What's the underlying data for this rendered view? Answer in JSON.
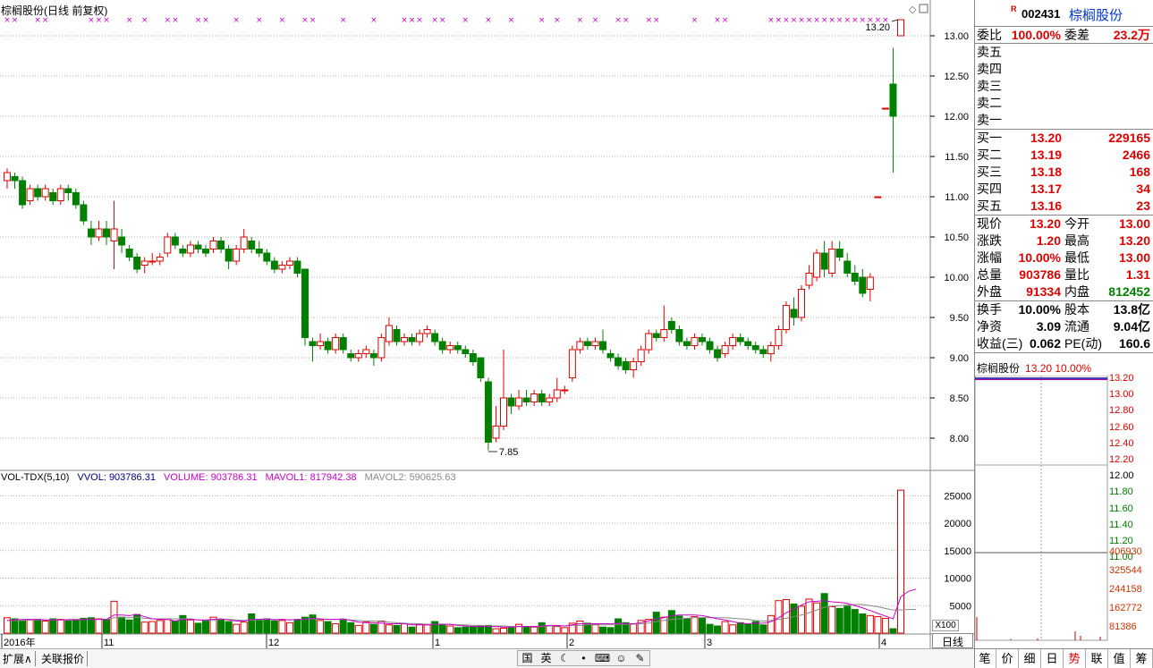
{
  "title": "棕榈股份(日线 前复权)",
  "legend": {
    "name": "VOL-TDX(5,10)",
    "vvol": "VVOL: 903786.31",
    "volume": "VOLUME: 903786.31",
    "mavol1": "MAVOL1: 817942.38",
    "mavol2": "MAVOL2: 590625.63"
  },
  "price_axis_labels": [
    "13.00",
    "12.50",
    "12.00",
    "11.50",
    "11.00",
    "10.50",
    "10.00",
    "9.50",
    "9.00",
    "8.50",
    "8.00"
  ],
  "vol_axis_labels": [
    "25000",
    "20000",
    "15000",
    "10000",
    "5000"
  ],
  "vol_unit": "X100",
  "x_labels": [
    "2016年",
    "11",
    "12",
    "1",
    "2",
    "3",
    "4"
  ],
  "annotations": {
    "high": "13.20",
    "low": "7.85"
  },
  "period_label": "日线",
  "bottom_tabs": [
    "扩展∧",
    "关联报价"
  ],
  "ime_icons": [
    "国",
    "英",
    "moon-icon",
    "dot-icon",
    "keyboard-icon",
    "person-icon",
    "wrench-icon"
  ],
  "colors": {
    "up": "#e00000",
    "down": "#008000",
    "ma1": "#cc00cc",
    "ma2": "#888888",
    "grid": "#999999",
    "x_marker": "#cc00cc"
  },
  "quote": {
    "code": "002431",
    "name": "棕榈股份",
    "r_mark": "R",
    "wb_label": "委比",
    "wb_value": "100.00%",
    "wc_label": "委差",
    "wc_value": "23.2万",
    "sell_labels": [
      "卖五",
      "卖四",
      "卖三",
      "卖二",
      "卖一"
    ],
    "buy": [
      {
        "label": "买一",
        "price": "13.20",
        "qty": "229165"
      },
      {
        "label": "买二",
        "price": "13.19",
        "qty": "2466"
      },
      {
        "label": "买三",
        "price": "13.18",
        "qty": "168"
      },
      {
        "label": "买四",
        "price": "13.17",
        "qty": "34"
      },
      {
        "label": "买五",
        "price": "13.16",
        "qty": "23"
      }
    ],
    "stats1": [
      {
        "l1": "现价",
        "v1": "13.20",
        "c1": "red",
        "l2": "今开",
        "v2": "13.00",
        "c2": "red"
      },
      {
        "l1": "涨跌",
        "v1": "1.20",
        "c1": "red",
        "l2": "最高",
        "v2": "13.20",
        "c2": "red"
      },
      {
        "l1": "涨幅",
        "v1": "10.00%",
        "c1": "red",
        "l2": "最低",
        "v2": "13.00",
        "c2": "red"
      },
      {
        "l1": "总量",
        "v1": "903786",
        "c1": "red",
        "l2": "量比",
        "v2": "1.31",
        "c2": "red"
      },
      {
        "l1": "外盘",
        "v1": "91334",
        "c1": "red",
        "l2": "内盘",
        "v2": "812452",
        "c2": "green"
      }
    ],
    "stats2": [
      {
        "l1": "换手",
        "v1": "10.00%",
        "c1": "blk",
        "l2": "股本",
        "v2": "13.8亿",
        "c2": "blk"
      },
      {
        "l1": "净资",
        "v1": "3.09",
        "c1": "blk",
        "l2": "流通",
        "v2": "9.04亿",
        "c2": "blk"
      },
      {
        "l1": "收益(三)",
        "v1": "0.062",
        "c1": "blk",
        "l2": "PE(动)",
        "v2": "160.6",
        "c2": "blk"
      }
    ],
    "mini_title": "棕榈股份",
    "mini_price": "13.20 10.00%",
    "mini_price_labels": [
      "13.20",
      "13.00",
      "12.80",
      "12.60",
      "12.40",
      "12.20",
      "12.00",
      "11.80",
      "11.60",
      "11.40",
      "11.20",
      "11.00"
    ],
    "mini_vol_labels": [
      "406930",
      "325544",
      "244158",
      "162772",
      "81386"
    ],
    "tabs": [
      "笔",
      "价",
      "细",
      "日",
      "势",
      "联",
      "值",
      "筹"
    ],
    "active_tab": "势"
  },
  "chart_data": {
    "type": "candlestick",
    "title": "棕榈股份(日线 前复权)",
    "x_labels": [
      "2016年",
      "11",
      "12",
      "1",
      "2",
      "3",
      "4"
    ],
    "y_range": [
      7.6,
      13.2
    ],
    "volume_range": [
      0,
      27000
    ],
    "candles": [
      [
        11.2,
        11.3,
        11.1,
        11.35
      ],
      [
        11.25,
        11.2,
        11.1,
        11.3
      ],
      [
        11.2,
        10.9,
        10.85,
        11.25
      ],
      [
        10.95,
        11.1,
        10.9,
        11.15
      ],
      [
        11.1,
        11.0,
        10.95,
        11.15
      ],
      [
        11.0,
        11.1,
        10.95,
        11.15
      ],
      [
        11.05,
        10.95,
        10.9,
        11.1
      ],
      [
        10.95,
        11.1,
        10.9,
        11.15
      ],
      [
        11.1,
        11.05,
        10.95,
        11.15
      ],
      [
        11.05,
        10.9,
        10.85,
        11.1
      ],
      [
        10.9,
        10.7,
        10.65,
        10.95
      ],
      [
        10.6,
        10.5,
        10.4,
        10.7
      ],
      [
        10.5,
        10.6,
        10.45,
        10.7
      ],
      [
        10.6,
        10.5,
        10.4,
        10.7
      ],
      [
        10.45,
        10.6,
        10.1,
        10.95
      ],
      [
        10.5,
        10.4,
        10.3,
        10.6
      ],
      [
        10.35,
        10.25,
        10.2,
        10.4
      ],
      [
        10.25,
        10.1,
        10.05,
        10.3
      ],
      [
        10.15,
        10.2,
        10.05,
        10.25
      ],
      [
        10.2,
        10.2,
        10.15,
        10.3
      ],
      [
        10.2,
        10.25,
        10.15,
        10.3
      ],
      [
        10.3,
        10.5,
        10.25,
        10.55
      ],
      [
        10.5,
        10.4,
        10.35,
        10.55
      ],
      [
        10.35,
        10.3,
        10.25,
        10.4
      ],
      [
        10.3,
        10.4,
        10.25,
        10.45
      ],
      [
        10.4,
        10.35,
        10.3,
        10.45
      ],
      [
        10.35,
        10.3,
        10.25,
        10.4
      ],
      [
        10.35,
        10.45,
        10.3,
        10.5
      ],
      [
        10.45,
        10.35,
        10.3,
        10.5
      ],
      [
        10.35,
        10.2,
        10.1,
        10.4
      ],
      [
        10.2,
        10.35,
        10.15,
        10.4
      ],
      [
        10.35,
        10.5,
        10.3,
        10.6
      ],
      [
        10.45,
        10.35,
        10.3,
        10.5
      ],
      [
        10.35,
        10.3,
        10.25,
        10.45
      ],
      [
        10.3,
        10.2,
        10.15,
        10.35
      ],
      [
        10.2,
        10.1,
        10.05,
        10.25
      ],
      [
        10.1,
        10.15,
        10.05,
        10.2
      ],
      [
        10.15,
        10.2,
        10.1,
        10.25
      ],
      [
        10.2,
        10.05,
        10.0,
        10.25
      ],
      [
        10.1,
        9.25,
        9.15,
        10.1
      ],
      [
        9.2,
        9.15,
        8.95,
        9.25
      ],
      [
        9.15,
        9.2,
        9.1,
        9.3
      ],
      [
        9.2,
        9.1,
        9.05,
        9.25
      ],
      [
        9.1,
        9.25,
        9.05,
        9.3
      ],
      [
        9.25,
        9.1,
        9.05,
        9.3
      ],
      [
        9.05,
        9.0,
        8.95,
        9.1
      ],
      [
        9.0,
        9.05,
        8.95,
        9.1
      ],
      [
        9.05,
        9.1,
        9.0,
        9.15
      ],
      [
        9.05,
        9.0,
        8.9,
        9.1
      ],
      [
        9.0,
        9.25,
        8.95,
        9.3
      ],
      [
        9.2,
        9.4,
        9.15,
        9.5
      ],
      [
        9.35,
        9.2,
        9.15,
        9.4
      ],
      [
        9.2,
        9.25,
        9.15,
        9.3
      ],
      [
        9.25,
        9.2,
        9.15,
        9.3
      ],
      [
        9.2,
        9.3,
        9.15,
        9.35
      ],
      [
        9.3,
        9.35,
        9.25,
        9.4
      ],
      [
        9.3,
        9.2,
        9.15,
        9.35
      ],
      [
        9.2,
        9.1,
        9.05,
        9.25
      ],
      [
        9.1,
        9.15,
        9.05,
        9.2
      ],
      [
        9.15,
        9.1,
        9.05,
        9.2
      ],
      [
        9.1,
        9.05,
        9.0,
        9.15
      ],
      [
        9.05,
        8.95,
        8.9,
        9.1
      ],
      [
        9.0,
        8.75,
        8.7,
        9.0
      ],
      [
        8.7,
        7.95,
        7.85,
        8.75
      ],
      [
        8.0,
        8.15,
        7.95,
        8.4
      ],
      [
        8.15,
        8.5,
        8.1,
        9.1
      ],
      [
        8.5,
        8.4,
        8.3,
        8.55
      ],
      [
        8.4,
        8.5,
        8.35,
        8.6
      ],
      [
        8.5,
        8.45,
        8.4,
        8.6
      ],
      [
        8.45,
        8.55,
        8.4,
        8.6
      ],
      [
        8.55,
        8.45,
        8.4,
        8.6
      ],
      [
        8.45,
        8.5,
        8.4,
        8.55
      ],
      [
        8.5,
        8.6,
        8.45,
        8.75
      ],
      [
        8.6,
        8.6,
        8.55,
        8.65
      ],
      [
        8.75,
        9.1,
        8.7,
        9.15
      ],
      [
        9.1,
        9.2,
        9.05,
        9.25
      ],
      [
        9.2,
        9.15,
        9.1,
        9.25
      ],
      [
        9.15,
        9.2,
        9.1,
        9.25
      ],
      [
        9.2,
        9.1,
        9.05,
        9.35
      ],
      [
        9.05,
        9.0,
        8.95,
        9.1
      ],
      [
        9.0,
        8.9,
        8.85,
        9.05
      ],
      [
        8.95,
        8.85,
        8.8,
        9.0
      ],
      [
        8.85,
        8.95,
        8.75,
        9.0
      ],
      [
        8.95,
        9.1,
        8.9,
        9.15
      ],
      [
        9.1,
        9.3,
        9.05,
        9.35
      ],
      [
        9.3,
        9.25,
        9.2,
        9.35
      ],
      [
        9.25,
        9.35,
        9.2,
        9.65
      ],
      [
        9.45,
        9.35,
        9.3,
        9.5
      ],
      [
        9.35,
        9.2,
        9.15,
        9.4
      ],
      [
        9.2,
        9.15,
        9.1,
        9.25
      ],
      [
        9.15,
        9.25,
        9.1,
        9.3
      ],
      [
        9.25,
        9.2,
        9.15,
        9.3
      ],
      [
        9.2,
        9.1,
        9.05,
        9.25
      ],
      [
        9.1,
        9.0,
        8.95,
        9.15
      ],
      [
        9.05,
        9.15,
        9.0,
        9.2
      ],
      [
        9.15,
        9.25,
        9.1,
        9.3
      ],
      [
        9.25,
        9.2,
        9.15,
        9.3
      ],
      [
        9.2,
        9.15,
        9.1,
        9.25
      ],
      [
        9.15,
        9.1,
        9.05,
        9.2
      ],
      [
        9.1,
        9.05,
        9.0,
        9.15
      ],
      [
        9.05,
        9.15,
        8.95,
        9.2
      ],
      [
        9.15,
        9.35,
        9.1,
        9.4
      ],
      [
        9.35,
        9.65,
        9.3,
        9.7
      ],
      [
        9.6,
        9.5,
        9.4,
        9.75
      ],
      [
        9.5,
        9.85,
        9.45,
        9.9
      ],
      [
        9.9,
        10.05,
        9.85,
        10.15
      ],
      [
        10.0,
        10.3,
        9.95,
        10.35
      ],
      [
        10.3,
        10.1,
        10.0,
        10.45
      ],
      [
        10.05,
        10.35,
        10.0,
        10.45
      ],
      [
        10.35,
        10.25,
        10.2,
        10.45
      ],
      [
        10.2,
        10.05,
        10.0,
        10.3
      ],
      [
        10.05,
        9.95,
        9.9,
        10.15
      ],
      [
        10.0,
        9.8,
        9.75,
        10.1
      ],
      [
        9.85,
        10.0,
        9.7,
        10.05
      ],
      [
        11.0,
        11.0,
        11.0,
        11.0
      ],
      [
        12.1,
        12.1,
        12.1,
        12.1
      ],
      [
        12.4,
        12.0,
        11.3,
        12.85
      ],
      [
        13.0,
        13.2,
        13.0,
        13.2
      ]
    ],
    "volumes": [
      2.8,
      2.6,
      2.3,
      2.4,
      2.5,
      2.2,
      2.6,
      2.5,
      2.2,
      2.4,
      2.7,
      2.8,
      2.6,
      2.5,
      5.8,
      2.9,
      2.4,
      3.4,
      2.0,
      2.1,
      2.3,
      2.5,
      2.2,
      3.2,
      2.4,
      1.8,
      2.3,
      2.9,
      2.5,
      2.1,
      1.6,
      2.0,
      3.5,
      2.5,
      2.6,
      2.2,
      2.3,
      1.9,
      2.4,
      2.9,
      3.3,
      2.3,
      2.1,
      1.7,
      2.5,
      1.9,
      1.4,
      2.0,
      1.6,
      2.2,
      1.5,
      1.4,
      1.7,
      1.1,
      1.6,
      1.5,
      2.1,
      1.6,
      1.3,
      1.0,
      1.1,
      1.2,
      1.3,
      1.4,
      0.8,
      0.9,
      1.0,
      1.6,
      1.2,
      1.1,
      1.9,
      1.3,
      1.2,
      1.0,
      1.8,
      2.2,
      1.8,
      1.6,
      1.1,
      1.0,
      2.6,
      1.9,
      1.7,
      2.3,
      2.5,
      3.8,
      2.9,
      4.1,
      3.1,
      2.6,
      3.0,
      2.8,
      1.6,
      1.3,
      2.1,
      1.5,
      1.9,
      1.6,
      2.1,
      1.5,
      3.2,
      5.9,
      6.1,
      5.3,
      4.9,
      6.2,
      5.5,
      7.2,
      4.8,
      4.5,
      4.9,
      4.3,
      3.5,
      3.2,
      3.0,
      2.7,
      0.8,
      26.0,
      9.0,
      0.6
    ],
    "ma1": [
      2.3,
      2.4,
      2.5,
      2.5,
      2.5,
      2.4,
      2.4,
      2.4,
      2.4,
      2.4,
      2.5,
      2.5,
      2.5,
      2.5,
      3.3,
      3.3,
      3.2,
      3.4,
      3.0,
      2.6,
      2.5,
      2.5,
      2.2,
      2.5,
      2.5,
      2.4,
      2.4,
      2.5,
      2.6,
      2.4,
      2.2,
      2.2,
      2.5,
      2.5,
      2.6,
      2.4,
      2.5,
      2.4,
      2.5,
      2.5,
      2.7,
      2.6,
      2.5,
      2.5,
      2.6,
      2.3,
      2.0,
      1.9,
      1.9,
      1.8,
      1.7,
      1.7,
      1.7,
      1.5,
      1.5,
      1.5,
      1.6,
      1.6,
      1.6,
      1.4,
      1.3,
      1.2,
      1.2,
      1.2,
      1.2,
      1.1,
      1.1,
      1.2,
      1.2,
      1.2,
      1.3,
      1.4,
      1.4,
      1.3,
      1.5,
      1.7,
      1.7,
      1.7,
      1.7,
      1.7,
      1.8,
      1.7,
      1.7,
      1.9,
      2.2,
      2.6,
      2.8,
      3.2,
      3.3,
      3.3,
      3.3,
      3.2,
      2.9,
      2.6,
      2.4,
      2.1,
      1.8,
      1.7,
      1.8,
      1.8,
      2.1,
      2.8,
      3.7,
      4.4,
      5.1,
      5.7,
      5.8,
      5.9,
      5.7,
      5.6,
      5.4,
      5.0,
      4.6,
      4.1,
      3.6,
      3.1,
      2.6,
      6.6,
      7.6,
      8.0
    ],
    "ma2": [
      2.3,
      2.3,
      2.3,
      2.4,
      2.4,
      2.4,
      2.4,
      2.4,
      2.5,
      2.5,
      2.5,
      2.5,
      2.5,
      2.5,
      2.8,
      2.8,
      2.8,
      2.9,
      2.7,
      2.6,
      2.6,
      2.6,
      2.6,
      2.6,
      2.6,
      2.4,
      2.3,
      2.4,
      2.5,
      2.5,
      2.4,
      2.3,
      2.4,
      2.4,
      2.5,
      2.5,
      2.5,
      2.4,
      2.5,
      2.5,
      2.6,
      2.5,
      2.5,
      2.5,
      2.5,
      2.4,
      2.3,
      2.2,
      2.2,
      2.1,
      2.0,
      1.9,
      1.8,
      1.7,
      1.7,
      1.6,
      1.6,
      1.6,
      1.6,
      1.5,
      1.5,
      1.4,
      1.4,
      1.3,
      1.3,
      1.3,
      1.2,
      1.2,
      1.2,
      1.2,
      1.2,
      1.3,
      1.3,
      1.3,
      1.4,
      1.4,
      1.5,
      1.5,
      1.5,
      1.5,
      1.6,
      1.6,
      1.6,
      1.7,
      1.8,
      2.1,
      2.3,
      2.5,
      2.6,
      2.7,
      2.8,
      2.8,
      2.8,
      2.8,
      2.8,
      2.7,
      2.6,
      2.5,
      2.3,
      2.2,
      2.3,
      2.5,
      2.7,
      3.0,
      3.3,
      3.7,
      4.2,
      4.7,
      4.9,
      5.0,
      5.1,
      5.2,
      5.2,
      5.0,
      4.8,
      4.5,
      4.2,
      4.2,
      4.3,
      4.3
    ]
  }
}
